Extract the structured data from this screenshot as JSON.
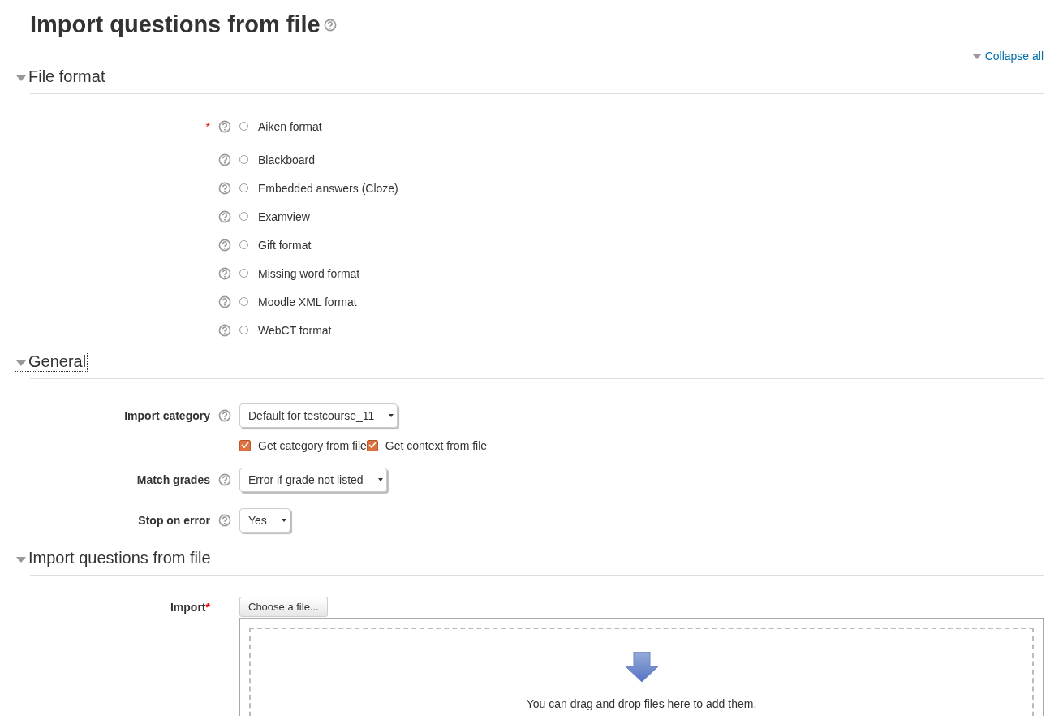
{
  "title": "Import questions from file",
  "collapse_all": {
    "label": "Collapse all"
  },
  "sections": [
    {
      "kind": "radios",
      "title": "File format",
      "expanded": true,
      "focused": false,
      "required_mark": "*",
      "options": [
        {
          "label": "Aiken format",
          "selected": false
        },
        {
          "label": "Blackboard",
          "selected": false
        },
        {
          "label": "Embedded answers (Cloze)",
          "selected": false
        },
        {
          "label": "Examview",
          "selected": false
        },
        {
          "label": "Gift format",
          "selected": false
        },
        {
          "label": "Missing word format",
          "selected": false
        },
        {
          "label": "Moodle XML format",
          "selected": false
        },
        {
          "label": "WebCT format",
          "selected": false
        }
      ]
    },
    {
      "kind": "fields",
      "title": "General",
      "expanded": true,
      "focused": true,
      "fields": [
        {
          "kind": "select",
          "label": "Import category",
          "value": "Default for testcourse_11"
        },
        {
          "kind": "checkboxes",
          "items": [
            {
              "label": "Get category from file",
              "checked": true
            },
            {
              "label": "Get context from file",
              "checked": true
            }
          ]
        },
        {
          "kind": "select",
          "label": "Match grades",
          "value": "Error if grade not listed"
        },
        {
          "kind": "select",
          "label": "Stop on error",
          "value": "Yes"
        }
      ]
    },
    {
      "kind": "file",
      "title": "Import questions from file",
      "expanded": true,
      "focused": false,
      "label": "Import",
      "required_mark": "*",
      "button": "Choose a file...",
      "drop_hint": "You can drag and drop files here to add them."
    }
  ]
}
